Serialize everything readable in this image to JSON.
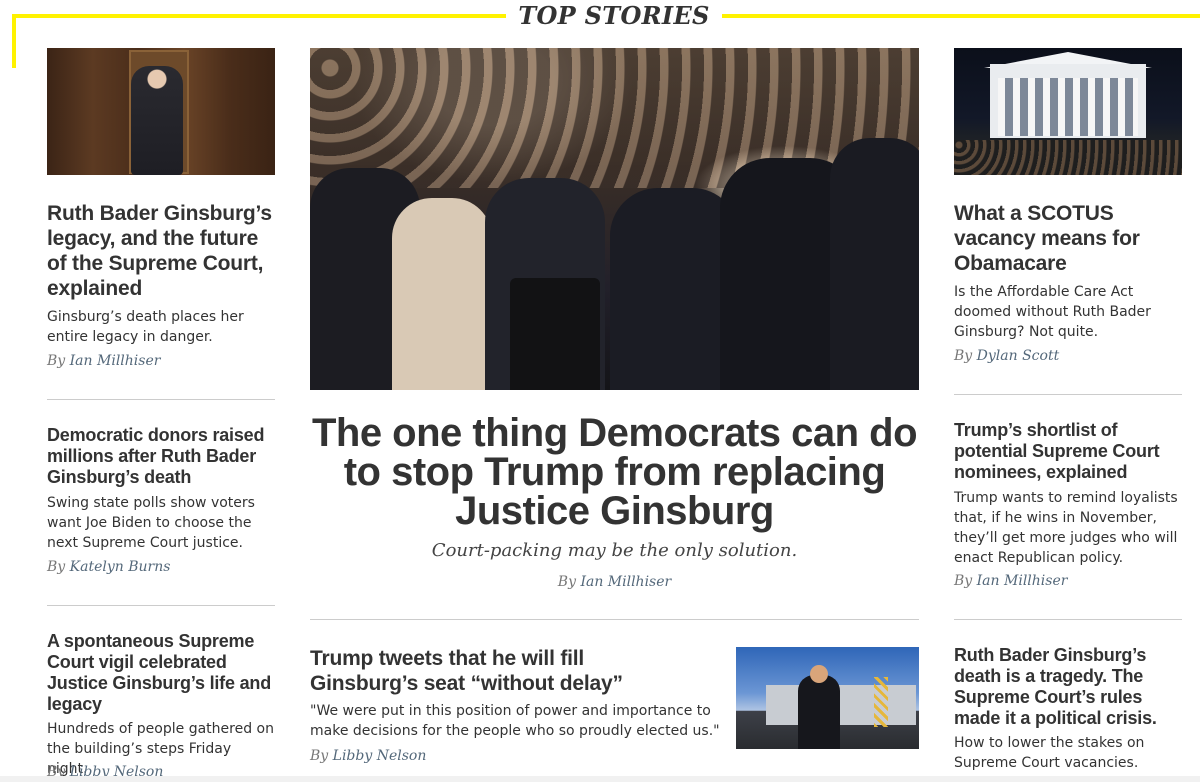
{
  "section": {
    "title": "TOP STORIES"
  },
  "articles": {
    "left1": {
      "headline": "Ruth Bader Ginsburg’s legacy, and the future of the Supreme Court, explained",
      "dek": "Ginsburg’s death places her entire legacy in danger.",
      "by": "By",
      "author": "Ian Millhiser"
    },
    "left2": {
      "headline": "Democratic donors raised millions after Ruth Bader Ginsburg’s death",
      "dek": "Swing state polls show voters want Joe Biden to choose the next Supreme Court justice.",
      "by": "By",
      "author": "Katelyn Burns"
    },
    "left3": {
      "headline": "A spontaneous Supreme Court vigil celebrated Justice Ginsburg’s life and legacy",
      "dek": "Hundreds of people gathered on the building’s steps Friday night.",
      "by": "By",
      "author": "Libby Nelson"
    },
    "hero": {
      "headline": "The one thing Democrats can do to stop Trump from replacing Justice Ginsburg",
      "dek": "Court-packing may be the only solution.",
      "by": "By",
      "author": "Ian Millhiser"
    },
    "center2": {
      "headline": "Trump tweets that he will fill Ginsburg’s seat “without delay”",
      "dek": "\"We were put in this position of power and importance to make decisions for the people who so proudly elected us.\"",
      "by": "By",
      "author": "Libby Nelson"
    },
    "right1": {
      "headline": "What a SCOTUS vacancy means for Obamacare",
      "dek": "Is the Affordable Care Act doomed without Ruth Bader Ginsburg? Not quite.",
      "by": "By",
      "author": "Dylan Scott"
    },
    "right2": {
      "headline": "Trump’s shortlist of potential Supreme Court nominees, explained",
      "dek": "Trump wants to remind loyalists that, if he wins in November, they’ll get more judges who will enact Republican policy.",
      "by": "By",
      "author": "Ian Millhiser"
    },
    "right3": {
      "headline": "Ruth Bader Ginsburg’s death is a tragedy. The Supreme Court’s rules made it a political crisis.",
      "dek": "How to lower the stakes on Supreme Court vacancies."
    }
  },
  "colors": {
    "accent": "#fff200",
    "author": "#54687a",
    "rule": "#cccccc",
    "text": "#333333"
  }
}
